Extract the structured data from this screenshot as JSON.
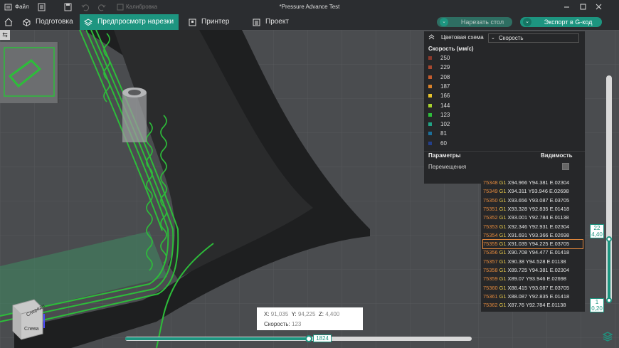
{
  "titlebar": {
    "file_label": "Файл",
    "calibration_label": "Калибровка",
    "window_title": "*Pressure Advance Test"
  },
  "tabs": {
    "prepare": "Подготовка",
    "preview": "Предпросмотр нарезки",
    "printer": "Принтер",
    "project": "Проект"
  },
  "actions": {
    "slice_plate": "Нарезать стол",
    "export_gcode": "Экспорт в G-код"
  },
  "minimap": {
    "arrow": "⇆"
  },
  "legend": {
    "scheme_label": "Цветовая схема",
    "scheme_value": "Скорость",
    "header": "Скорость (мм/с)",
    "items": [
      {
        "value": "250",
        "color": "#8c3a2c"
      },
      {
        "value": "229",
        "color": "#a8482f"
      },
      {
        "value": "208",
        "color": "#c45c2e"
      },
      {
        "value": "187",
        "color": "#d9822a"
      },
      {
        "value": "166",
        "color": "#e6c32c"
      },
      {
        "value": "144",
        "color": "#a6d12e"
      },
      {
        "value": "123",
        "color": "#2dbd3a"
      },
      {
        "value": "102",
        "color": "#21a385"
      },
      {
        "value": "81",
        "color": "#1c6f9a"
      },
      {
        "value": "60",
        "color": "#233f8a"
      }
    ],
    "params_label": "Параметры",
    "visibility_label": "Видимость",
    "travel_label": "Перемещения"
  },
  "gcode": [
    {
      "n": "75348",
      "g": "G1",
      "t": "X94.966 Y94.381 E.02304"
    },
    {
      "n": "75349",
      "g": "G1",
      "t": "X94.311 Y93.946 E.02698"
    },
    {
      "n": "75350",
      "g": "G1",
      "t": "X93.656 Y93.087 E.03705"
    },
    {
      "n": "75351",
      "g": "G1",
      "t": "X93.328 Y92.835 E.01418"
    },
    {
      "n": "75352",
      "g": "G1",
      "t": "X93.001 Y92.784 E.01138"
    },
    {
      "n": "75353",
      "g": "G1",
      "t": "X92.346 Y92.931 E.02304"
    },
    {
      "n": "75354",
      "g": "G1",
      "t": "X91.691 Y93.366 E.02698"
    },
    {
      "n": "75355",
      "g": "G1",
      "t": "X91.035 Y94.225 E.03705"
    },
    {
      "n": "75356",
      "g": "G1",
      "t": "X90.708 Y94.477 E.01418"
    },
    {
      "n": "75357",
      "g": "G1",
      "t": "X90.38 Y94.528 E.01138"
    },
    {
      "n": "75358",
      "g": "G1",
      "t": "X89.725 Y94.381 E.02304"
    },
    {
      "n": "75359",
      "g": "G1",
      "t": "X89.07 Y93.946 E.02698"
    },
    {
      "n": "75360",
      "g": "G1",
      "t": "X88.415 Y93.087 E.03705"
    },
    {
      "n": "75361",
      "g": "G1",
      "t": "X88.087 Y92.835 E.01418"
    },
    {
      "n": "75362",
      "g": "G1",
      "t": "X87.76 Y92.784 E.01138"
    }
  ],
  "layer_slider": {
    "top_layer": "22",
    "top_height": "4,40",
    "bottom_layer": "1",
    "bottom_height": "0,20"
  },
  "move_slider": {
    "value": "1824",
    "fraction": 0.53
  },
  "coords": {
    "x_label": "X:",
    "x": "91,035",
    "y_label": "Y:",
    "y": "94,225",
    "z_label": "Z:",
    "z": "4,400",
    "speed_label": "Скорость:",
    "speed": "123"
  },
  "view_cube": {
    "left_face": "Слева",
    "front_face": "Спереди"
  },
  "colors": {
    "accent": "#1d9580",
    "extrusion_green": "#2dbd3a",
    "highlight_orange": "#e2883c"
  }
}
